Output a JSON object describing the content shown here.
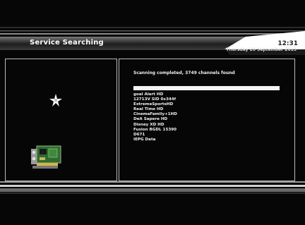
{
  "header": {
    "title": "Service Searching",
    "time": "12:31",
    "date": "Thursday 26 September 2013"
  },
  "left_panel": {
    "icons": [
      "satellite-star-icon",
      "tuner-card-icon"
    ]
  },
  "scan": {
    "status": "Scanning completed, 3749 channels found",
    "progress": 1.0
  },
  "channels": [
    "goal Alert HD",
    "12713V SID 0x344f",
    "ExtremeSportsHD",
    "Real Time HD",
    "CinemaFamily+1HD",
    "DeA Sapere HD",
    "Disney XD HD",
    "Fusion BGDL 15390",
    "D671",
    "IEPG Data"
  ],
  "colors": {
    "background": "#060606",
    "panel_border": "#bdbdbd",
    "text": "#f2f2f2",
    "progress": "#f3f3f3"
  }
}
